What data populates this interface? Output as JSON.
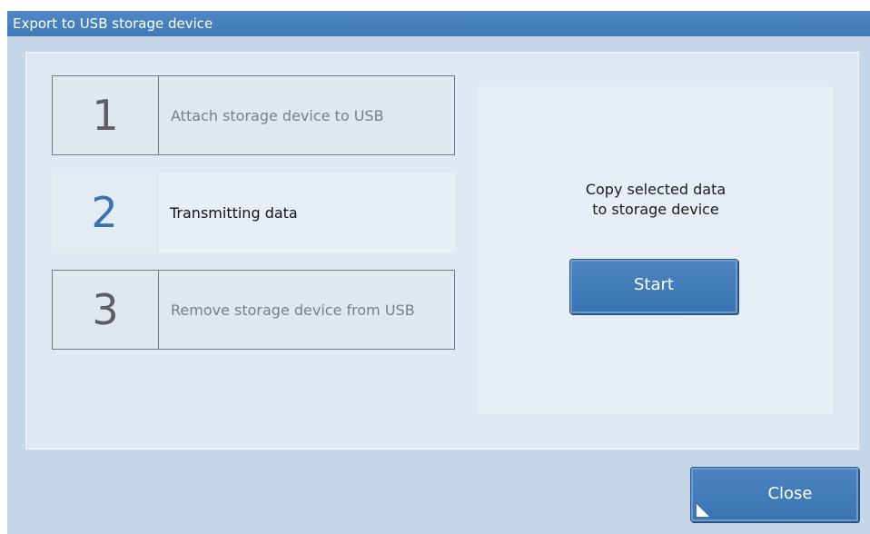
{
  "window": {
    "title": "Export to USB storage device"
  },
  "steps": [
    {
      "number": "1",
      "label": "Attach storage device to USB",
      "state": "inactive"
    },
    {
      "number": "2",
      "label": "Transmitting data",
      "state": "active"
    },
    {
      "number": "3",
      "label": "Remove storage device from USB",
      "state": "inactive"
    }
  ],
  "action": {
    "text": "Copy selected data\nto storage device",
    "start_label": "Start"
  },
  "footer": {
    "close_label": "Close"
  },
  "colors": {
    "accent": "#3f79b7",
    "dialog_bg": "#c6d7ea",
    "panel_bg": "#dfe8f4",
    "active_step_number": "#3a73b0"
  }
}
